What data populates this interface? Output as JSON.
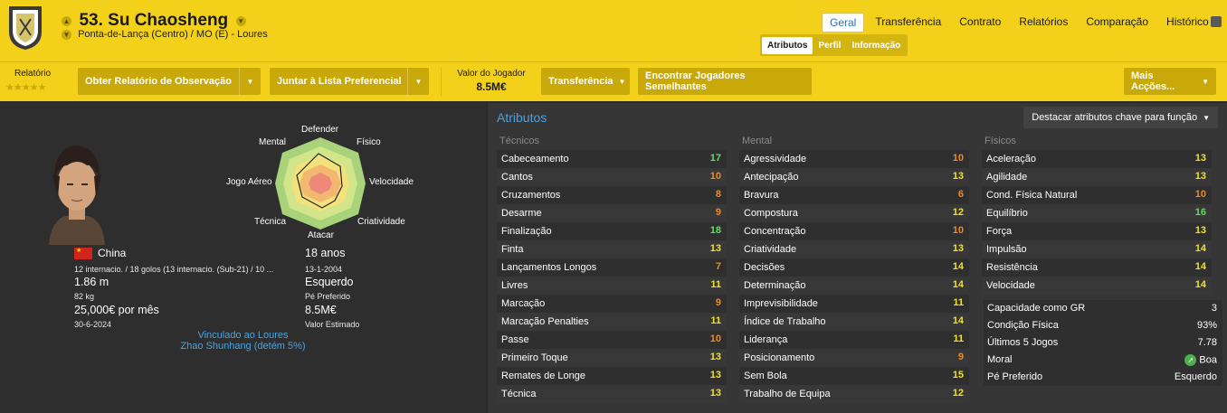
{
  "header": {
    "title": "53. Su Chaosheng",
    "subtitle": "Ponta-de-Lança (Centro) / MO (E) - Loures",
    "nav": [
      "Geral",
      "Transferência",
      "Contrato",
      "Relatórios",
      "Comparação",
      "Histórico"
    ],
    "active_nav": "Geral",
    "subnav": [
      "Atributos",
      "Perfil",
      "Informação"
    ],
    "active_subnav": "Atributos"
  },
  "toolbar": {
    "report_label": "Relatório",
    "stars": "★★★★★",
    "scout_report": "Obter Relatório de Observação",
    "shortlist": "Juntar à Lista Preferencial",
    "value_label": "Valor do Jogador",
    "value": "8.5M€",
    "transfer": "Transferência",
    "similar": "Encontrar Jogadores Semelhantes",
    "more": "Mais Acções..."
  },
  "radar_labels": {
    "defender": "Defender",
    "fisico": "Físico",
    "velocidade": "Velocidade",
    "criatividade": "Criatividade",
    "atacar": "Atacar",
    "tecnica": "Técnica",
    "jogo_aereo": "Jogo Aéreo",
    "mental": "Mental"
  },
  "profile": {
    "nation": "China",
    "caps": "12 internacio. / 18 golos (13 internacio. (Sub-21) / 10 ...",
    "height": "1.86 m",
    "weight": "82 kg",
    "wage": "25,000€ por mês",
    "contract_end": "30-6-2024",
    "age": "18 anos",
    "dob": "13-1-2004",
    "foot": "Esquerdo",
    "foot_label": "Pé Preferido",
    "value": "8.5M€",
    "value_label": "Valor Estimado",
    "linked": "Vinculado ao Loures",
    "owner": "Zhao Shunhang (detém 5%)"
  },
  "attributes": {
    "title": "Atributos",
    "highlight_button": "Destacar atributos chave para função",
    "tecnicos_label": "Técnicos",
    "mental_label": "Mental",
    "fisicos_label": "Físicos",
    "tecnicos": [
      {
        "name": "Cabeceamento",
        "value": "17"
      },
      {
        "name": "Cantos",
        "value": "10"
      },
      {
        "name": "Cruzamentos",
        "value": "8"
      },
      {
        "name": "Desarme",
        "value": "9"
      },
      {
        "name": "Finalização",
        "value": "18"
      },
      {
        "name": "Finta",
        "value": "13"
      },
      {
        "name": "Lançamentos Longos",
        "value": "7"
      },
      {
        "name": "Livres",
        "value": "11"
      },
      {
        "name": "Marcação",
        "value": "9"
      },
      {
        "name": "Marcação Penalties",
        "value": "11"
      },
      {
        "name": "Passe",
        "value": "10"
      },
      {
        "name": "Primeiro Toque",
        "value": "13"
      },
      {
        "name": "Remates de Longe",
        "value": "13"
      },
      {
        "name": "Técnica",
        "value": "13"
      }
    ],
    "mental": [
      {
        "name": "Agressividade",
        "value": "10"
      },
      {
        "name": "Antecipação",
        "value": "13"
      },
      {
        "name": "Bravura",
        "value": "6"
      },
      {
        "name": "Compostura",
        "value": "12"
      },
      {
        "name": "Concentração",
        "value": "10"
      },
      {
        "name": "Criatividade",
        "value": "13"
      },
      {
        "name": "Decisões",
        "value": "14"
      },
      {
        "name": "Determinação",
        "value": "14"
      },
      {
        "name": "Imprevisibilidade",
        "value": "11"
      },
      {
        "name": "Índice de Trabalho",
        "value": "14"
      },
      {
        "name": "Liderança",
        "value": "11"
      },
      {
        "name": "Posicionamento",
        "value": "9"
      },
      {
        "name": "Sem Bola",
        "value": "15"
      },
      {
        "name": "Trabalho de Equipa",
        "value": "12"
      }
    ],
    "fisicos": [
      {
        "name": "Aceleração",
        "value": "13"
      },
      {
        "name": "Agilidade",
        "value": "13"
      },
      {
        "name": "Cond. Física Natural",
        "value": "10"
      },
      {
        "name": "Equilíbrio",
        "value": "16"
      },
      {
        "name": "Força",
        "value": "13"
      },
      {
        "name": "Impulsão",
        "value": "14"
      },
      {
        "name": "Resistência",
        "value": "14"
      },
      {
        "name": "Velocidade",
        "value": "14"
      }
    ],
    "extra": [
      {
        "name": "Capacidade como GR",
        "value": "3"
      },
      {
        "name": "Condição Física",
        "value": "93%"
      },
      {
        "name": "Últimos 5 Jogos",
        "value": "7.78"
      },
      {
        "name": "Moral",
        "value": "Boa"
      },
      {
        "name": "Pé Preferido",
        "value": "Esquerdo"
      }
    ]
  },
  "colors": {
    "header_yellow": "#f3d01a",
    "value_green": "#5ee05e",
    "value_yellow": "#f5e11a",
    "value_orange": "#f08a1c",
    "link_blue": "#4aa3df"
  }
}
